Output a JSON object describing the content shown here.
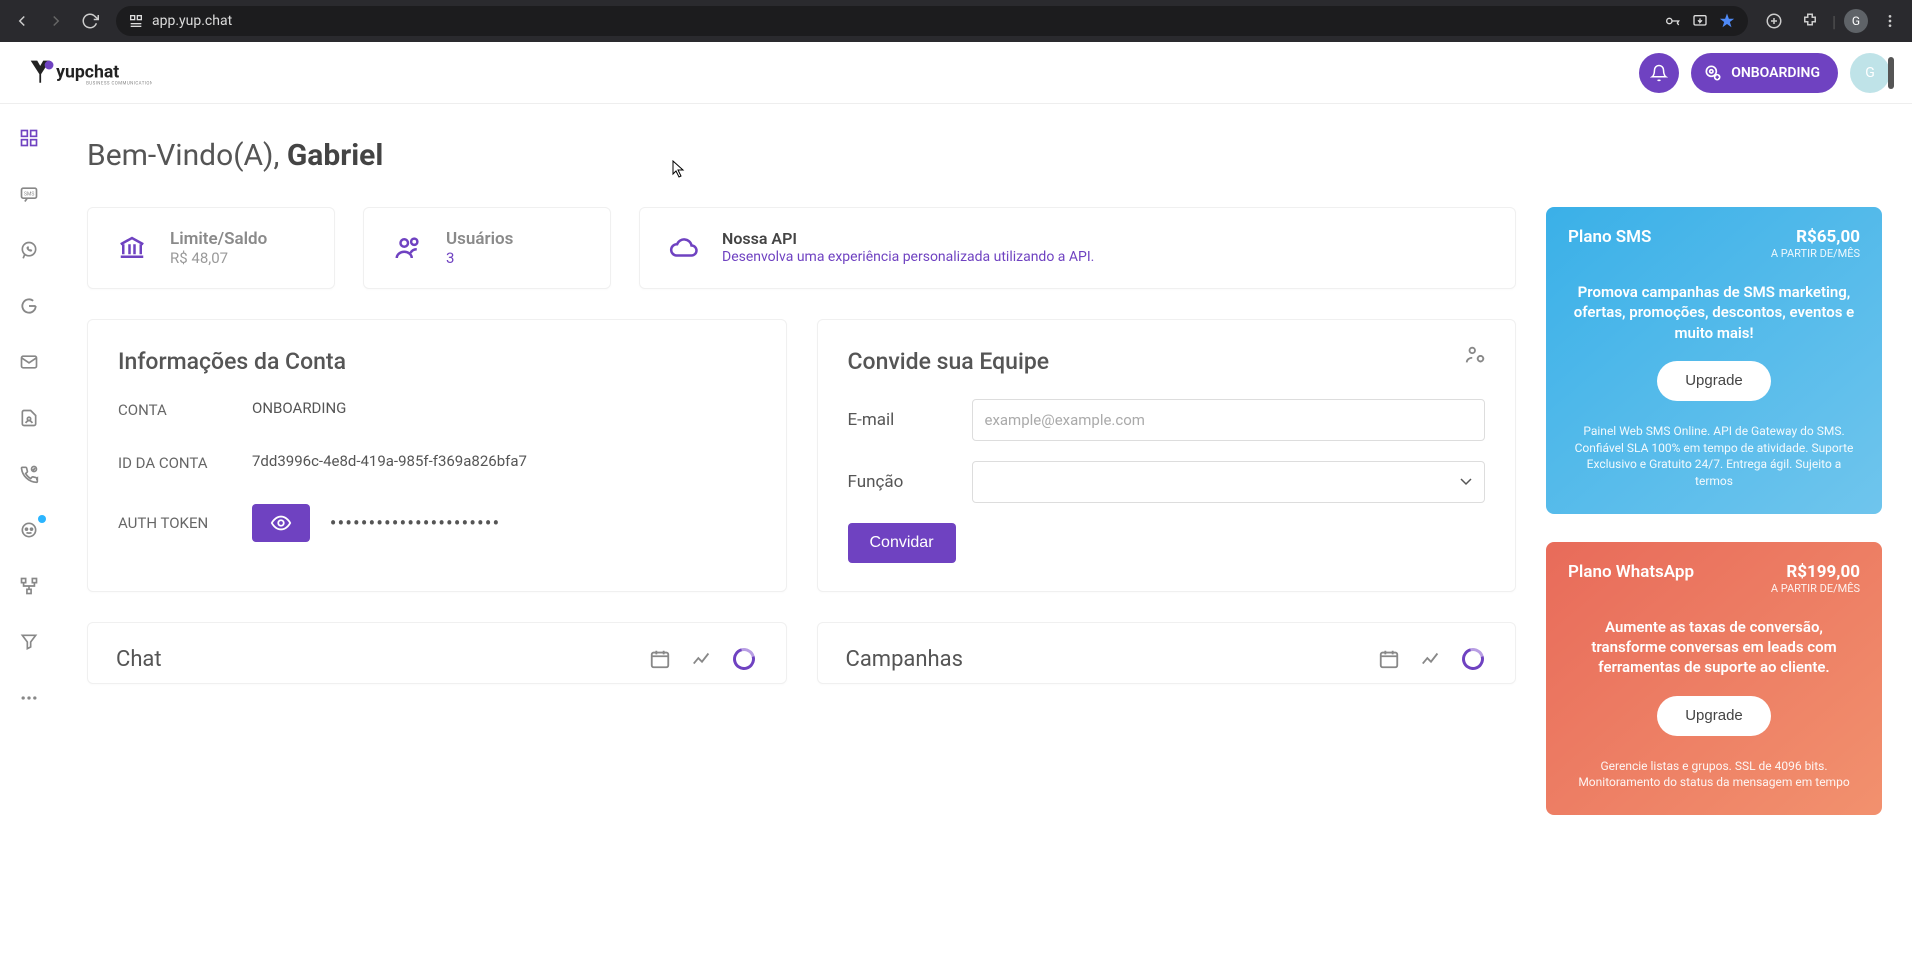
{
  "browser": {
    "url": "app.yup.chat",
    "avatar_letter": "G"
  },
  "header": {
    "onboarding_label": "ONBOARDING",
    "avatar_letter": "G"
  },
  "welcome": {
    "prefix": "Bem-Vindo(A), ",
    "name": "Gabriel"
  },
  "stats": {
    "balance_label": "Limite/Saldo",
    "balance_value": "R$ 48,07",
    "users_label": "Usuários",
    "users_value": "3",
    "api_label": "Nossa API",
    "api_desc": "Desenvolva uma experiência personalizada utilizando a API."
  },
  "account_info": {
    "title": "Informações da Conta",
    "account_label": "CONTA",
    "account_value": "ONBOARDING",
    "id_label": "ID DA CONTA",
    "id_value": "7dd3996c-4e8d-419a-985f-f369a826bfa7",
    "token_label": "AUTH TOKEN",
    "token_value": "••••••••••••••••••••••"
  },
  "invite": {
    "title": "Convide sua Equipe",
    "email_label": "E-mail",
    "email_placeholder": "example@example.com",
    "role_label": "Função",
    "button": "Convidar"
  },
  "sections": {
    "chat": "Chat",
    "campaigns": "Campanhas"
  },
  "plans": {
    "sms": {
      "name": "Plano SMS",
      "price": "R$65,00",
      "per": "A PARTIR DE/MÊS",
      "desc": "Promova campanhas de SMS marketing, ofertas, promoções, descontos, eventos e muito mais!",
      "upgrade": "Upgrade",
      "note": "Painel Web SMS Online. API de Gateway do SMS. Confiável SLA 100% em tempo de atividade. Suporte Exclusivo e Gratuito 24/7. Entrega ágil. Sujeito a termos"
    },
    "whatsapp": {
      "name": "Plano WhatsApp",
      "price": "R$199,00",
      "per": "A PARTIR DE/MÊS",
      "desc": "Aumente as taxas de conversão, transforme conversas em leads com ferramentas de suporte ao cliente.",
      "upgrade": "Upgrade",
      "note": "Gerencie listas e grupos. SSL de 4096 bits. Monitoramento do status da mensagem em tempo"
    }
  }
}
